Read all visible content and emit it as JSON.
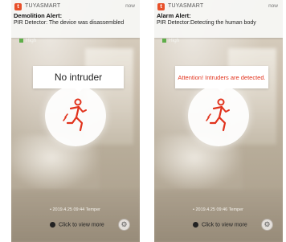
{
  "left": {
    "notification": {
      "app_icon": "tuya-logo-icon",
      "app_name": "TUYASMART",
      "time": "now",
      "title": "Demolition Alert:",
      "body": "PIR Detector: The device was disassembled"
    },
    "priority": "High",
    "status": "No intruder",
    "timestamp": "2019.4.25 09:44 Temper",
    "view_more": "Click to view more"
  },
  "right": {
    "notification": {
      "app_icon": "tuya-logo-icon",
      "app_name": "TUYASMART",
      "time": "now",
      "title": "Alarm Alert:",
      "body": "PIR Detector:Detecting the human body"
    },
    "priority": "High",
    "status": "Attention! Intruders are detected.",
    "timestamp": "2019.4.25 09:46 Temper",
    "view_more": "Click to view more"
  },
  "colors": {
    "accent_red": "#e1331d",
    "app_icon": "#e8502a",
    "priority_green": "#5fae4a"
  }
}
